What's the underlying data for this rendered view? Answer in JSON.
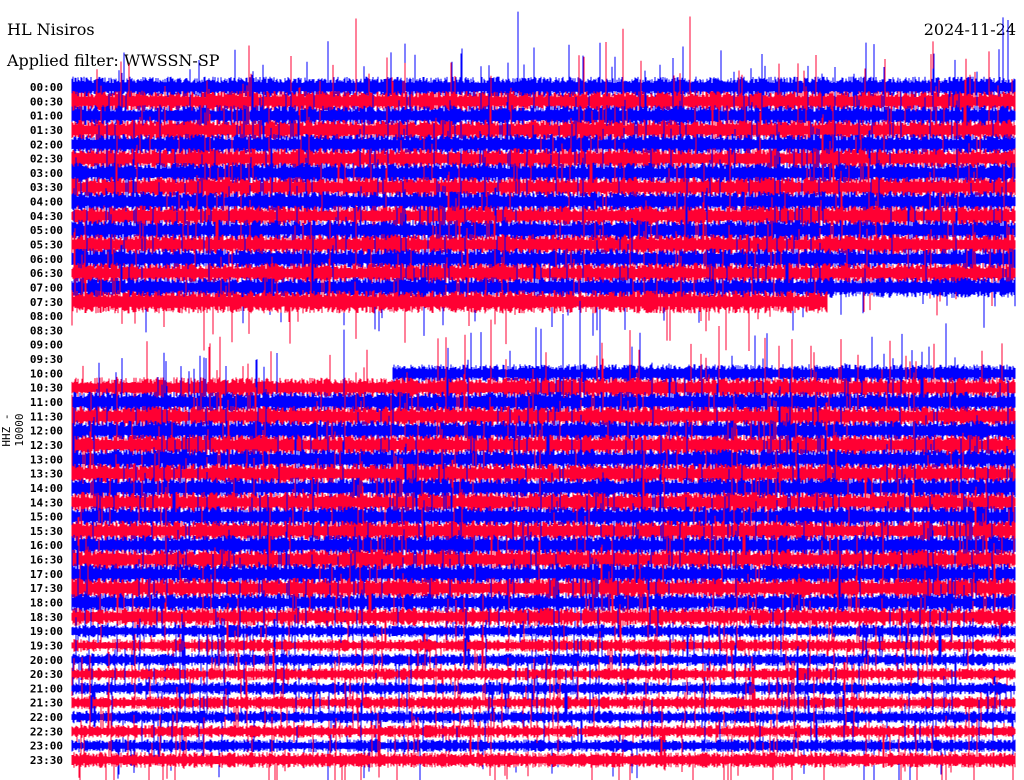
{
  "chart_data": {
    "type": "line",
    "title": "HL Nisiros",
    "subtitle": "Applied filter: WWSSN-SP",
    "date": "2024-11-24",
    "ylabel": "HHZ - 10000",
    "row_colors": [
      "#0000ff",
      "#ff0033"
    ],
    "rows": [
      {
        "label": "00:00",
        "start": 0,
        "end": 1,
        "level": 8
      },
      {
        "label": "00:30",
        "start": 0,
        "end": 1,
        "level": 8
      },
      {
        "label": "01:00",
        "start": 0,
        "end": 1,
        "level": 8
      },
      {
        "label": "01:30",
        "start": 0,
        "end": 1,
        "level": 8
      },
      {
        "label": "02:00",
        "start": 0,
        "end": 1,
        "level": 8
      },
      {
        "label": "02:30",
        "start": 0,
        "end": 1,
        "level": 8
      },
      {
        "label": "03:00",
        "start": 0,
        "end": 1,
        "level": 8
      },
      {
        "label": "03:30",
        "start": 0,
        "end": 1,
        "level": 8
      },
      {
        "label": "04:00",
        "start": 0,
        "end": 1,
        "level": 8
      },
      {
        "label": "04:30",
        "start": 0,
        "end": 1,
        "level": 8
      },
      {
        "label": "05:00",
        "start": 0,
        "end": 1,
        "level": 8
      },
      {
        "label": "05:30",
        "start": 0,
        "end": 1,
        "level": 8
      },
      {
        "label": "06:00",
        "start": 0,
        "end": 1,
        "level": 8
      },
      {
        "label": "06:30",
        "start": 0,
        "end": 1,
        "level": 8
      },
      {
        "label": "07:00",
        "start": 0,
        "end": 1,
        "level": 8
      },
      {
        "label": "07:30",
        "start": 0,
        "end": 0.8,
        "level": 9
      },
      {
        "label": "08:00",
        "start": 0,
        "end": 0,
        "level": 0
      },
      {
        "label": "08:30",
        "start": 0,
        "end": 0,
        "level": 0
      },
      {
        "label": "09:00",
        "start": 0,
        "end": 0,
        "level": 0
      },
      {
        "label": "09:30",
        "start": 0,
        "end": 0,
        "level": 0
      },
      {
        "label": "10:00",
        "start": 0.34,
        "end": 1,
        "level": 7
      },
      {
        "label": "10:30",
        "start": 0,
        "end": 1,
        "level": 8
      },
      {
        "label": "11:00",
        "start": 0,
        "end": 1,
        "level": 8
      },
      {
        "label": "11:30",
        "start": 0,
        "end": 1,
        "level": 8
      },
      {
        "label": "12:00",
        "start": 0,
        "end": 1,
        "level": 8
      },
      {
        "label": "12:30",
        "start": 0,
        "end": 1,
        "level": 8
      },
      {
        "label": "13:00",
        "start": 0,
        "end": 1,
        "level": 8
      },
      {
        "label": "13:30",
        "start": 0,
        "end": 1,
        "level": 8
      },
      {
        "label": "14:00",
        "start": 0,
        "end": 1,
        "level": 8
      },
      {
        "label": "14:30",
        "start": 0,
        "end": 1,
        "level": 8
      },
      {
        "label": "15:00",
        "start": 0,
        "end": 1,
        "level": 8
      },
      {
        "label": "15:30",
        "start": 0,
        "end": 1,
        "level": 8
      },
      {
        "label": "16:00",
        "start": 0,
        "end": 1,
        "level": 8
      },
      {
        "label": "16:30",
        "start": 0,
        "end": 1,
        "level": 8
      },
      {
        "label": "17:00",
        "start": 0,
        "end": 1,
        "level": 8
      },
      {
        "label": "17:30",
        "start": 0,
        "end": 1,
        "level": 8
      },
      {
        "label": "18:00",
        "start": 0,
        "end": 1,
        "level": 7
      },
      {
        "label": "18:30",
        "start": 0,
        "end": 1,
        "level": 7
      },
      {
        "label": "19:00",
        "start": 0,
        "end": 1,
        "level": 5
      },
      {
        "label": "19:30",
        "start": 0,
        "end": 1,
        "level": 5
      },
      {
        "label": "20:00",
        "start": 0,
        "end": 1,
        "level": 5
      },
      {
        "label": "20:30",
        "start": 0,
        "end": 1,
        "level": 5
      },
      {
        "label": "21:00",
        "start": 0,
        "end": 1,
        "level": 5
      },
      {
        "label": "21:30",
        "start": 0,
        "end": 1,
        "level": 5
      },
      {
        "label": "22:00",
        "start": 0,
        "end": 1,
        "level": 5
      },
      {
        "label": "22:30",
        "start": 0,
        "end": 1,
        "level": 5
      },
      {
        "label": "23:00",
        "start": 0,
        "end": 1,
        "level": 5
      },
      {
        "label": "23:30",
        "start": 0,
        "end": 1,
        "level": 6
      }
    ]
  }
}
